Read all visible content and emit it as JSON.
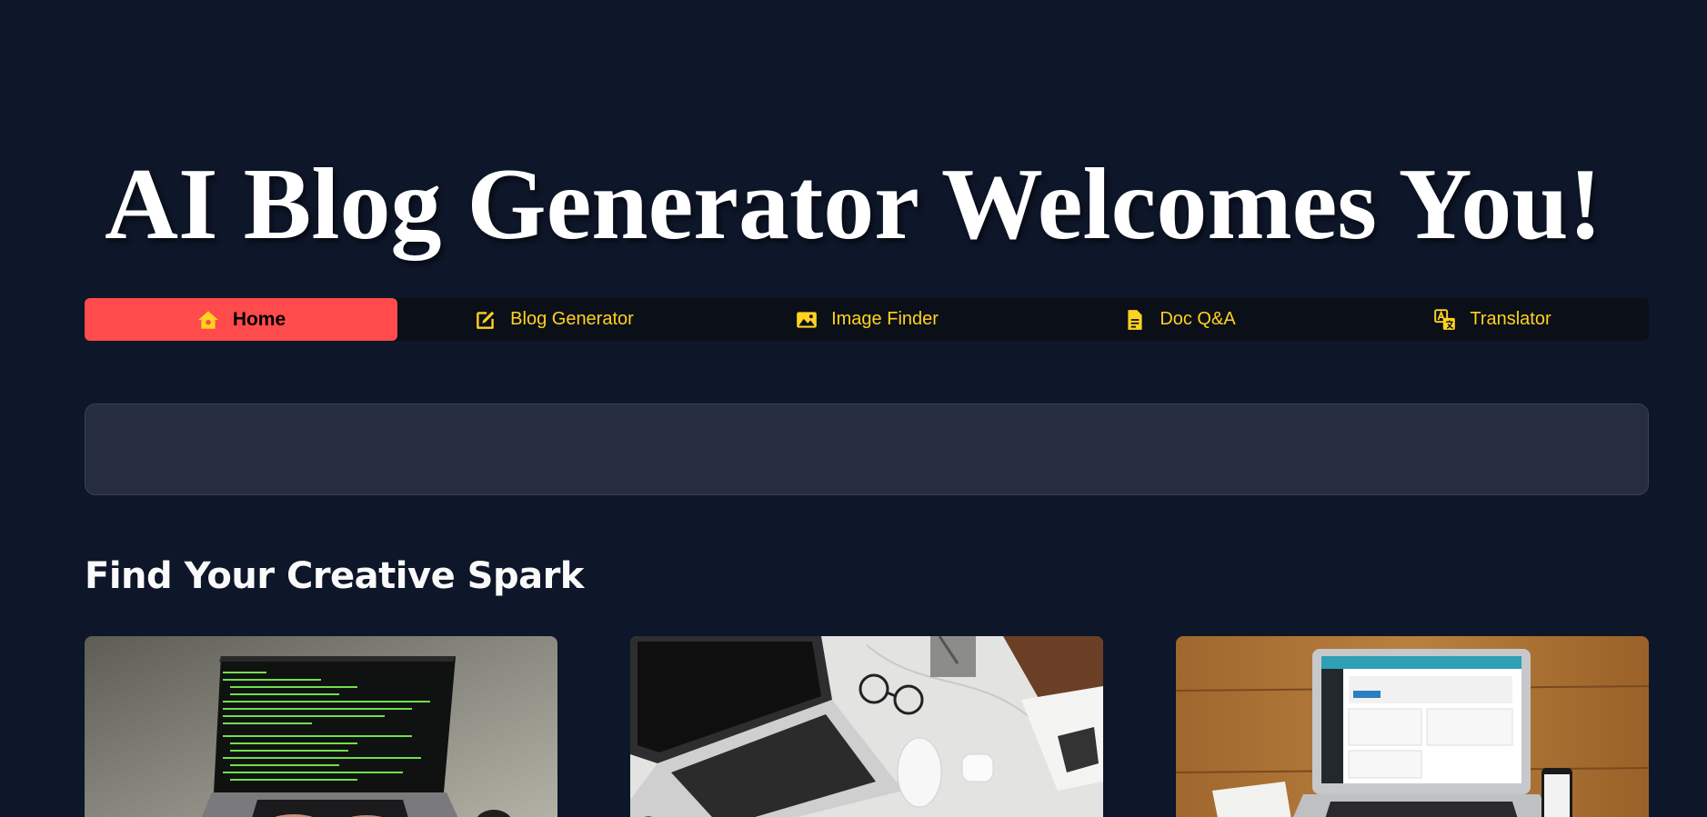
{
  "header": {
    "title": "AI Blog Generator Welcomes You!"
  },
  "nav": {
    "items": [
      {
        "label": "Home",
        "icon": "home-icon",
        "active": true
      },
      {
        "label": "Blog Generator",
        "icon": "edit-icon",
        "active": false
      },
      {
        "label": "Image Finder",
        "icon": "image-icon",
        "active": false
      },
      {
        "label": "Doc Q&A",
        "icon": "document-icon",
        "active": false
      },
      {
        "label": "Translator",
        "icon": "translate-icon",
        "active": false
      }
    ]
  },
  "input": {
    "value": ""
  },
  "section": {
    "heading": "Find Your Creative Spark"
  },
  "colors": {
    "background": "#0e1629",
    "nav_background": "#0b0f17",
    "active_tab": "#ff4b4b",
    "nav_text": "#ffd21f",
    "input_background": "#262d3e"
  }
}
